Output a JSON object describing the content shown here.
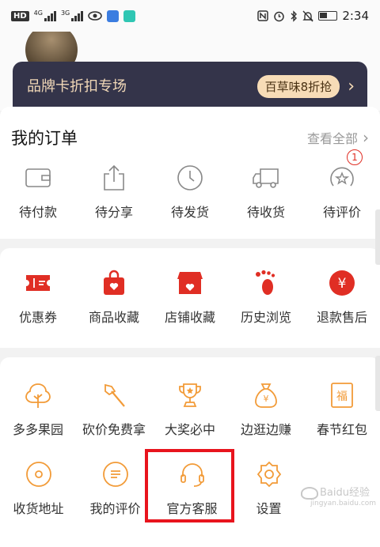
{
  "status_bar": {
    "network_label": "HD",
    "signal_1_tag": "4G",
    "signal_2_tag": "3G",
    "time": "2:34"
  },
  "brand_banner": {
    "title": "品牌卡折扣专场",
    "pill": "百草味8折抢",
    "arrow": "›"
  },
  "orders": {
    "title": "我的订单",
    "view_all": "查看全部",
    "view_all_chevron": "›",
    "items": [
      {
        "label": "待付款",
        "icon": "wallet-icon"
      },
      {
        "label": "待分享",
        "icon": "share-icon"
      },
      {
        "label": "待发货",
        "icon": "clock-icon"
      },
      {
        "label": "待收货",
        "icon": "truck-icon"
      },
      {
        "label": "待评价",
        "icon": "review-star-icon",
        "badge": "1"
      }
    ]
  },
  "favorites": {
    "items": [
      {
        "label": "优惠券",
        "icon": "coupon-icon"
      },
      {
        "label": "商品收藏",
        "icon": "bag-heart-icon"
      },
      {
        "label": "店铺收藏",
        "icon": "store-heart-icon"
      },
      {
        "label": "历史浏览",
        "icon": "footprint-icon"
      },
      {
        "label": "退款售后",
        "icon": "yuan-icon"
      }
    ]
  },
  "tools": {
    "row1": [
      {
        "label": "多多果园",
        "icon": "tree-icon"
      },
      {
        "label": "砍价免费拿",
        "icon": "axe-icon"
      },
      {
        "label": "大奖必中",
        "icon": "trophy-icon"
      },
      {
        "label": "边逛边赚",
        "icon": "money-bag-icon"
      },
      {
        "label": "春节红包",
        "icon": "fu-envelope-icon"
      }
    ],
    "fu_char": "福",
    "yen_char": "¥",
    "row2": [
      {
        "label": "收货地址",
        "icon": "location-pin-icon"
      },
      {
        "label": "我的评价",
        "icon": "comment-icon"
      },
      {
        "label": "官方客服",
        "icon": "headset-icon"
      },
      {
        "label": "设置",
        "icon": "gear-icon"
      }
    ]
  },
  "colors": {
    "accent_red": "#e02e24",
    "accent_orange": "#f29b38",
    "banner_bg": "#34344a",
    "banner_text": "#f2d9b8",
    "highlight": "#e8141d"
  },
  "watermark": {
    "main": "Baidu经验",
    "sub": "jingyan.baidu.com"
  }
}
